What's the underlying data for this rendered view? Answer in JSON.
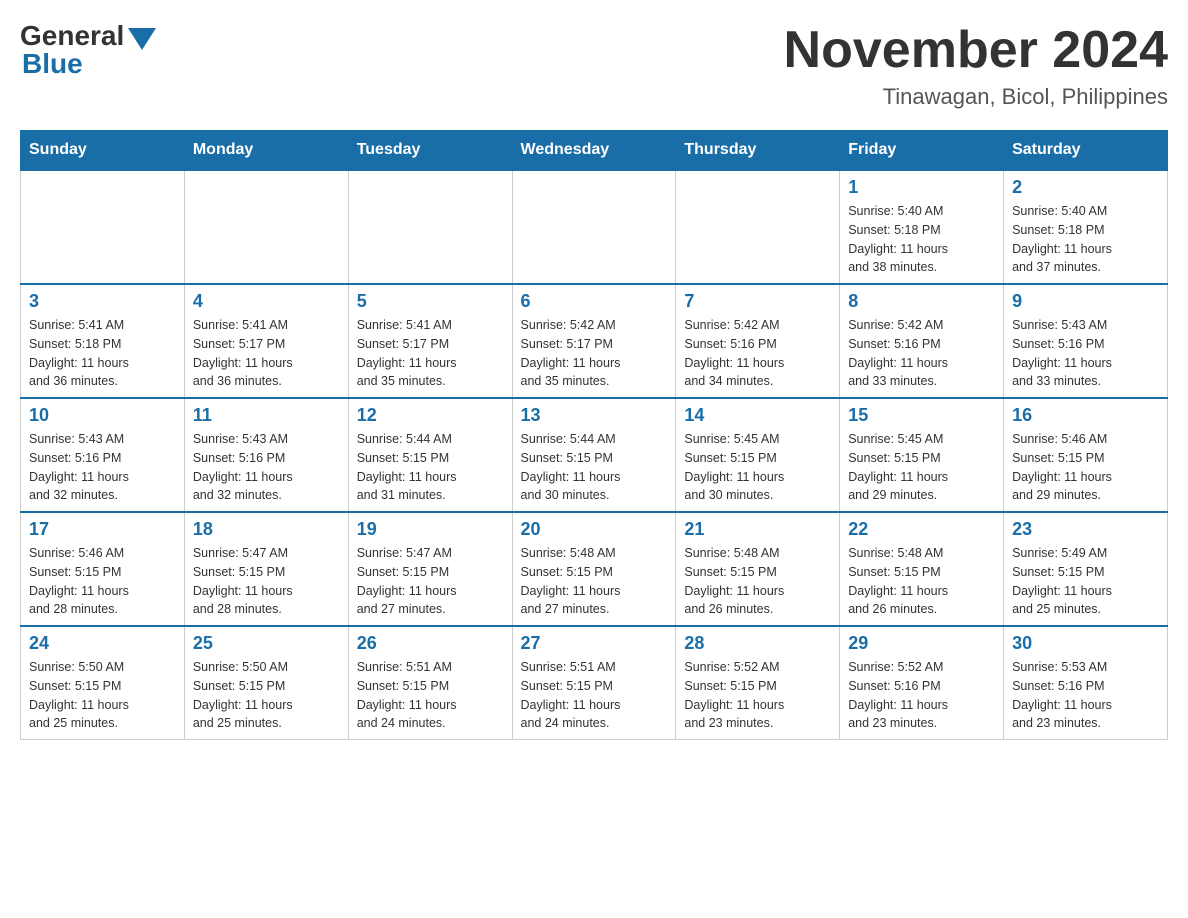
{
  "header": {
    "logo_general": "General",
    "logo_blue": "Blue",
    "month_title": "November 2024",
    "location": "Tinawagan, Bicol, Philippines"
  },
  "days_of_week": [
    "Sunday",
    "Monday",
    "Tuesday",
    "Wednesday",
    "Thursday",
    "Friday",
    "Saturday"
  ],
  "weeks": [
    [
      {
        "day": "",
        "info": ""
      },
      {
        "day": "",
        "info": ""
      },
      {
        "day": "",
        "info": ""
      },
      {
        "day": "",
        "info": ""
      },
      {
        "day": "",
        "info": ""
      },
      {
        "day": "1",
        "info": "Sunrise: 5:40 AM\nSunset: 5:18 PM\nDaylight: 11 hours\nand 38 minutes."
      },
      {
        "day": "2",
        "info": "Sunrise: 5:40 AM\nSunset: 5:18 PM\nDaylight: 11 hours\nand 37 minutes."
      }
    ],
    [
      {
        "day": "3",
        "info": "Sunrise: 5:41 AM\nSunset: 5:18 PM\nDaylight: 11 hours\nand 36 minutes."
      },
      {
        "day": "4",
        "info": "Sunrise: 5:41 AM\nSunset: 5:17 PM\nDaylight: 11 hours\nand 36 minutes."
      },
      {
        "day": "5",
        "info": "Sunrise: 5:41 AM\nSunset: 5:17 PM\nDaylight: 11 hours\nand 35 minutes."
      },
      {
        "day": "6",
        "info": "Sunrise: 5:42 AM\nSunset: 5:17 PM\nDaylight: 11 hours\nand 35 minutes."
      },
      {
        "day": "7",
        "info": "Sunrise: 5:42 AM\nSunset: 5:16 PM\nDaylight: 11 hours\nand 34 minutes."
      },
      {
        "day": "8",
        "info": "Sunrise: 5:42 AM\nSunset: 5:16 PM\nDaylight: 11 hours\nand 33 minutes."
      },
      {
        "day": "9",
        "info": "Sunrise: 5:43 AM\nSunset: 5:16 PM\nDaylight: 11 hours\nand 33 minutes."
      }
    ],
    [
      {
        "day": "10",
        "info": "Sunrise: 5:43 AM\nSunset: 5:16 PM\nDaylight: 11 hours\nand 32 minutes."
      },
      {
        "day": "11",
        "info": "Sunrise: 5:43 AM\nSunset: 5:16 PM\nDaylight: 11 hours\nand 32 minutes."
      },
      {
        "day": "12",
        "info": "Sunrise: 5:44 AM\nSunset: 5:15 PM\nDaylight: 11 hours\nand 31 minutes."
      },
      {
        "day": "13",
        "info": "Sunrise: 5:44 AM\nSunset: 5:15 PM\nDaylight: 11 hours\nand 30 minutes."
      },
      {
        "day": "14",
        "info": "Sunrise: 5:45 AM\nSunset: 5:15 PM\nDaylight: 11 hours\nand 30 minutes."
      },
      {
        "day": "15",
        "info": "Sunrise: 5:45 AM\nSunset: 5:15 PM\nDaylight: 11 hours\nand 29 minutes."
      },
      {
        "day": "16",
        "info": "Sunrise: 5:46 AM\nSunset: 5:15 PM\nDaylight: 11 hours\nand 29 minutes."
      }
    ],
    [
      {
        "day": "17",
        "info": "Sunrise: 5:46 AM\nSunset: 5:15 PM\nDaylight: 11 hours\nand 28 minutes."
      },
      {
        "day": "18",
        "info": "Sunrise: 5:47 AM\nSunset: 5:15 PM\nDaylight: 11 hours\nand 28 minutes."
      },
      {
        "day": "19",
        "info": "Sunrise: 5:47 AM\nSunset: 5:15 PM\nDaylight: 11 hours\nand 27 minutes."
      },
      {
        "day": "20",
        "info": "Sunrise: 5:48 AM\nSunset: 5:15 PM\nDaylight: 11 hours\nand 27 minutes."
      },
      {
        "day": "21",
        "info": "Sunrise: 5:48 AM\nSunset: 5:15 PM\nDaylight: 11 hours\nand 26 minutes."
      },
      {
        "day": "22",
        "info": "Sunrise: 5:48 AM\nSunset: 5:15 PM\nDaylight: 11 hours\nand 26 minutes."
      },
      {
        "day": "23",
        "info": "Sunrise: 5:49 AM\nSunset: 5:15 PM\nDaylight: 11 hours\nand 25 minutes."
      }
    ],
    [
      {
        "day": "24",
        "info": "Sunrise: 5:50 AM\nSunset: 5:15 PM\nDaylight: 11 hours\nand 25 minutes."
      },
      {
        "day": "25",
        "info": "Sunrise: 5:50 AM\nSunset: 5:15 PM\nDaylight: 11 hours\nand 25 minutes."
      },
      {
        "day": "26",
        "info": "Sunrise: 5:51 AM\nSunset: 5:15 PM\nDaylight: 11 hours\nand 24 minutes."
      },
      {
        "day": "27",
        "info": "Sunrise: 5:51 AM\nSunset: 5:15 PM\nDaylight: 11 hours\nand 24 minutes."
      },
      {
        "day": "28",
        "info": "Sunrise: 5:52 AM\nSunset: 5:15 PM\nDaylight: 11 hours\nand 23 minutes."
      },
      {
        "day": "29",
        "info": "Sunrise: 5:52 AM\nSunset: 5:16 PM\nDaylight: 11 hours\nand 23 minutes."
      },
      {
        "day": "30",
        "info": "Sunrise: 5:53 AM\nSunset: 5:16 PM\nDaylight: 11 hours\nand 23 minutes."
      }
    ]
  ]
}
